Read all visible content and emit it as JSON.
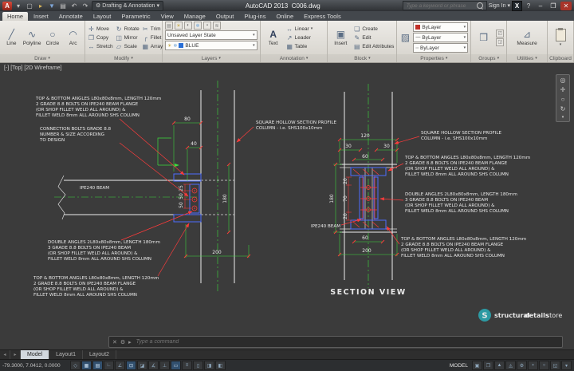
{
  "titlebar": {
    "app": "AutoCAD 2013",
    "doc": "C006.dwg",
    "workspace": "Drafting & Annotation",
    "search_placeholder": "Type a keyword or phrase",
    "sign_in": "Sign In"
  },
  "ribbon": {
    "tabs": [
      "Home",
      "Insert",
      "Annotate",
      "Layout",
      "Parametric",
      "View",
      "Manage",
      "Output",
      "Plug-ins",
      "Online",
      "Express Tools"
    ],
    "draw": {
      "label": "Draw",
      "line": "Line",
      "polyline": "Polyline",
      "circle": "Circle",
      "arc": "Arc"
    },
    "modify": {
      "label": "Modify",
      "move": "Move",
      "rotate": "Rotate",
      "trim": "Trim",
      "copy": "Copy",
      "mirror": "Mirror",
      "fillet": "Fillet",
      "stretch": "Stretch",
      "scale": "Scale",
      "array": "Array"
    },
    "layers": {
      "label": "Layers",
      "state": "Unsaved Layer State",
      "current": "BLUE"
    },
    "annotation": {
      "label": "Annotation",
      "text": "Text",
      "linear": "Linear",
      "leader": "Leader",
      "table": "Table"
    },
    "block": {
      "label": "Block",
      "insert": "Insert",
      "create": "Create",
      "edit": "Edit",
      "edit_attributes": "Edit Attributes"
    },
    "properties": {
      "label": "Properties",
      "bylayer": "ByLayer"
    },
    "groups": {
      "label": "Groups"
    },
    "utilities": {
      "label": "Utilities",
      "measure": "Measure"
    },
    "clipboard": {
      "label": "Clipboard"
    }
  },
  "viewport": {
    "min": "[-]",
    "view": "[Top]",
    "style": "[2D Wireframe]"
  },
  "drawing": {
    "notes": {
      "top_bottom_angles": [
        "TOP & BOTTOM ANGLES L80x80x8mm, LENGTH 120mm",
        "2 GRADE 8.8 BOLTS ON IPE240 BEAM FLANGE",
        "(OR SHOP FILLET WELD ALL AROUND) &",
        "FILLET WELD 8mm ALL AROUND SHS COLUMN"
      ],
      "double_angles": [
        "DOUBLE ANGLES 2L80x80x8mm, LENGTH 180mm",
        "3 GRADE 8.8 BOLTS ON IPE240 BEAM",
        "(OR SHOP FILLET WELD ALL AROUND) &",
        "FILLET WELD 8mm ALL AROUND SHS COLUMN"
      ],
      "connection_bolts": [
        "CONNECTION BOLTS GRADE 8.8",
        "NUMBER & SIZE ACCORDING",
        "TO DESIGN"
      ],
      "shs_column": [
        "SQUARE HOLLOW SECTION PROFILE",
        "COLUMN - i.e. SHS100x10mm"
      ],
      "ipe240": "IPE240 BEAM",
      "section_view": "SECTION VIEW"
    },
    "dims": {
      "v20": "20",
      "v25": "25",
      "v30": "30",
      "v40": "40",
      "v50": "50",
      "v60": "60",
      "v70": "70",
      "v80": "80",
      "v120": "120",
      "v180": "180",
      "v200": "200"
    },
    "logo": {
      "mark": "S",
      "part1": "structural",
      "part2": "details",
      "part3": "store"
    },
    "colors": {
      "geometry": "#d9d9d9",
      "dimension": "#3ddc3d",
      "leader": "#ff3b3b",
      "steel_angle": "#4d6dff",
      "centerline": "#3ddc3d",
      "background": "#3b3b3b"
    }
  },
  "command": {
    "hint": "Type a command"
  },
  "layout_tabs": [
    "Model",
    "Layout1",
    "Layout2"
  ],
  "statusbar": {
    "coords": "-79.3000, 7.0412, 0.0000",
    "model": "MODEL"
  }
}
